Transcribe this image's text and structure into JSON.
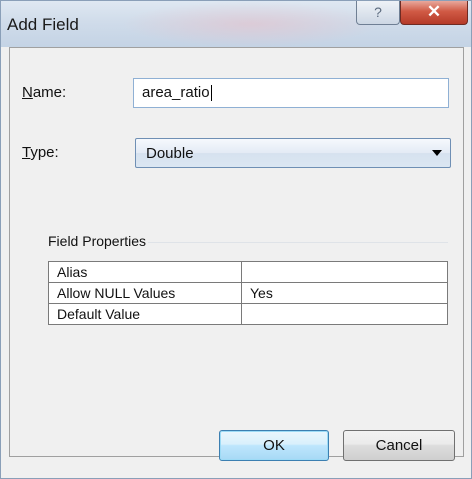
{
  "window": {
    "title": "Add Field",
    "help_glyph": "?",
    "close_glyph": "✕"
  },
  "form": {
    "name_label": "Name:",
    "name_value": "area_ratio",
    "type_label": "Type:",
    "type_value": "Double"
  },
  "field_properties": {
    "title": "Field Properties",
    "rows": [
      {
        "key": "Alias",
        "value": ""
      },
      {
        "key": "Allow NULL Values",
        "value": "Yes"
      },
      {
        "key": "Default Value",
        "value": ""
      }
    ]
  },
  "buttons": {
    "ok": "OK",
    "cancel": "Cancel"
  }
}
